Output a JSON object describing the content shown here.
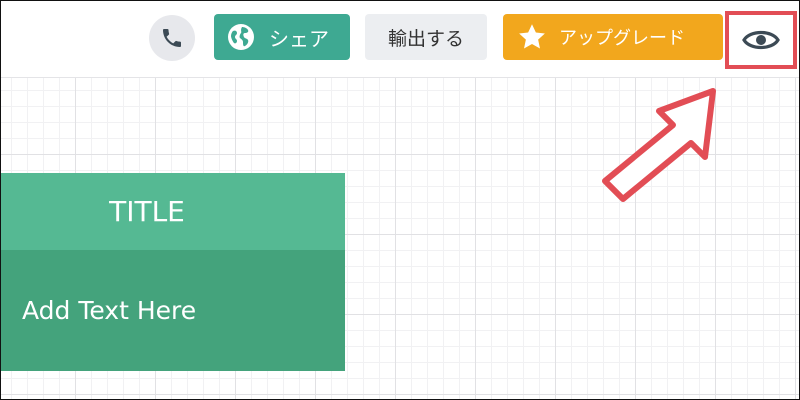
{
  "toolbar": {
    "share_label": "シェア",
    "export_label": "輸出する",
    "upgrade_label": "アップグレード"
  },
  "card": {
    "title": "TITLE",
    "body": "Add Text  Here"
  },
  "icons": {
    "phone": "phone-icon",
    "share": "globe-icon",
    "upgrade": "star-icon",
    "preview": "eye-icon",
    "annotation": "arrow-pointer-icon"
  },
  "colors": {
    "share_bg": "#3ea992",
    "upgrade_bg": "#f2a71d",
    "highlight": "#e24d55",
    "card_title_bg": "#55b993",
    "card_body_bg": "#44a37c"
  }
}
